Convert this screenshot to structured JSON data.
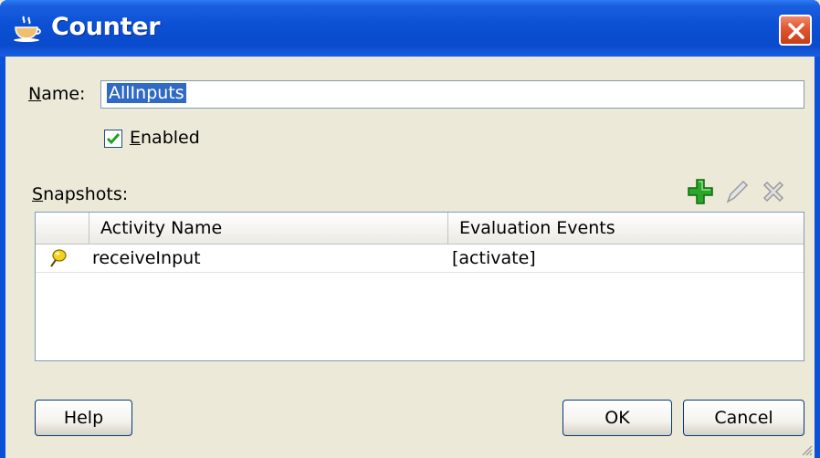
{
  "window": {
    "title": "Counter",
    "icon": "coffee-cup-icon",
    "close_icon": "close-icon"
  },
  "form": {
    "name_label": "Name:",
    "name_value": "AllInputs",
    "enabled_label": "Enabled",
    "enabled_checked": true,
    "snapshots_label": "Snapshots:"
  },
  "toolbar": {
    "add_icon": "add-icon",
    "edit_icon": "edit-icon",
    "delete_icon": "delete-icon"
  },
  "table": {
    "columns": [
      "",
      "Activity Name",
      "Evaluation Events"
    ],
    "rows": [
      {
        "icon": "pushpin-icon",
        "activity": "receiveInput",
        "events": "[activate]"
      }
    ]
  },
  "buttons": {
    "help": "Help",
    "ok": "OK",
    "cancel": "Cancel"
  },
  "colors": {
    "titlebar": "#0a4bcc",
    "dialog_bg": "#ece9d8",
    "close_button": "#e05a34",
    "selection": "#316ac5",
    "add_green": "#2aa62a"
  }
}
